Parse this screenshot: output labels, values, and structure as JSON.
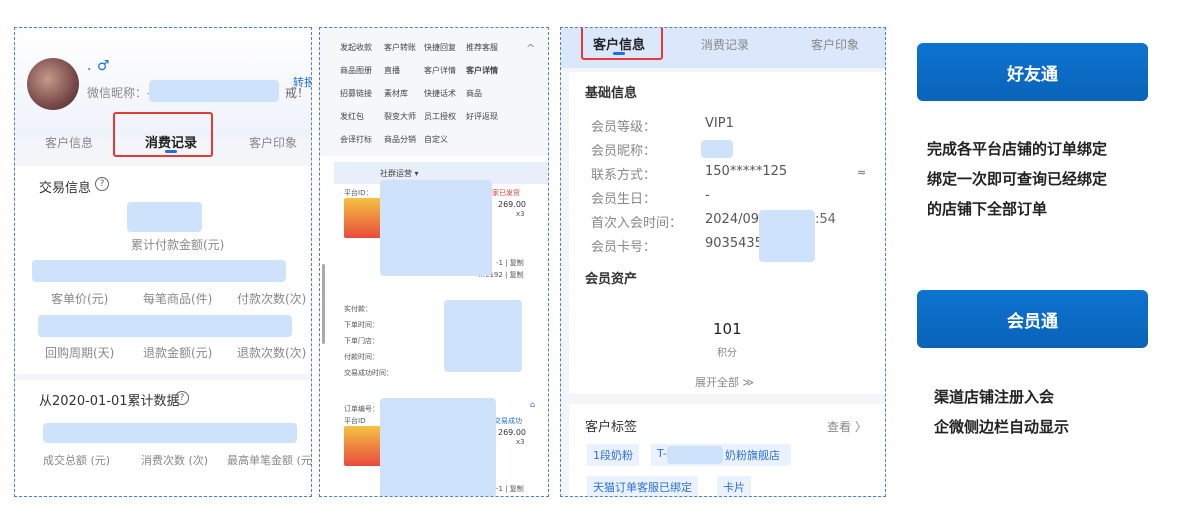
{
  "panel1": {
    "gender_icon": "♂",
    "name_dot": "·",
    "wechat_label": "微信昵称：-",
    "note_suffix": "戒！",
    "transfer_label": "转报",
    "tabs": [
      "客户信息",
      "消费记录",
      "客户印象"
    ],
    "trade_section": "交易信息",
    "help_icon": "?",
    "cumulative_label": "累计付款金额(元)",
    "stats_row1": [
      "客单价(元)",
      "每笔商品(件)",
      "付款次数(次)"
    ],
    "stats_row2": [
      "回购周期(天)",
      "退款金额(元)",
      "退款次数(次)"
    ],
    "since_section": "从2020-01-01累计数据",
    "stats_row3": [
      "成交总额 (元)",
      "消费次数 (次)",
      "最高单笔金额 (元)"
    ]
  },
  "panel2": {
    "grid_rows": [
      [
        "发起收款",
        "客户转账",
        "快捷回复",
        "推荐客服"
      ],
      [
        "商品图册",
        "直播",
        "客户详情",
        "客户详情"
      ],
      [
        "招募链接",
        "素材库",
        "快捷话术",
        "商品"
      ],
      [
        "发红包",
        "裂变大师",
        "员工授权",
        "好评返现"
      ],
      [
        "会译打标",
        "商品分销",
        "自定义"
      ]
    ],
    "collapse_icon": "^",
    "group_ops_label": "社群运营 ▾",
    "order1": {
      "platform": "平台ID：",
      "status": "家已发货",
      "amount": "269.00",
      "qty": "x3",
      "suffix": "-1 | 复制",
      "suffix2": "…0192 | 复制"
    },
    "payment_fields": [
      "实付款：",
      "下单时间：",
      "下单门店：",
      "付款时间：",
      "交易成功时间："
    ],
    "order2": {
      "order_no": "订单编号：",
      "platform": "平台ID",
      "status": "交易成功",
      "amount": "269.00",
      "qty": "x3",
      "suffix": "-1 | 复制"
    }
  },
  "panel3": {
    "tabs": [
      "客户信息",
      "消费记录",
      "客户印象"
    ],
    "basic_section": "基础信息",
    "fields": [
      {
        "label": "会员等级：",
        "value": "VIP1"
      },
      {
        "label": "会员昵称：",
        "value": ""
      },
      {
        "label": "联系方式：",
        "value": "150*****125"
      },
      {
        "label": "会员生日：",
        "value": "-"
      },
      {
        "label": "首次入会时间：",
        "value": "2024/09/"
      },
      {
        "label": "会员卡号：",
        "value": "9035435"
      }
    ],
    "join_time_suffix": ":54",
    "eye_icon": "≈",
    "assets_section": "会员资产",
    "points_value": "101",
    "points_label": "积分",
    "expand_label": "展开全部 ≫",
    "tags_section": "客户标签",
    "view_label": "查看 〉",
    "tags": [
      "1段奶粉",
      "T-",
      "奶粉旗舰店",
      "天猫订单客服已绑定",
      "卡片"
    ]
  },
  "right": {
    "btn1": "好友通",
    "desc1": [
      "完成各平台店铺的订单绑定",
      "绑定一次即可查询已经绑定",
      "的店铺下全部订单"
    ],
    "btn2": "会员通",
    "desc2": [
      "渠道店铺注册入会",
      "企微侧边栏自动显示"
    ]
  },
  "colors": {
    "accent": "#1e6fe0",
    "button": "#0a68c4",
    "highlight": "#e53935",
    "mask": "#cfe2fb"
  }
}
